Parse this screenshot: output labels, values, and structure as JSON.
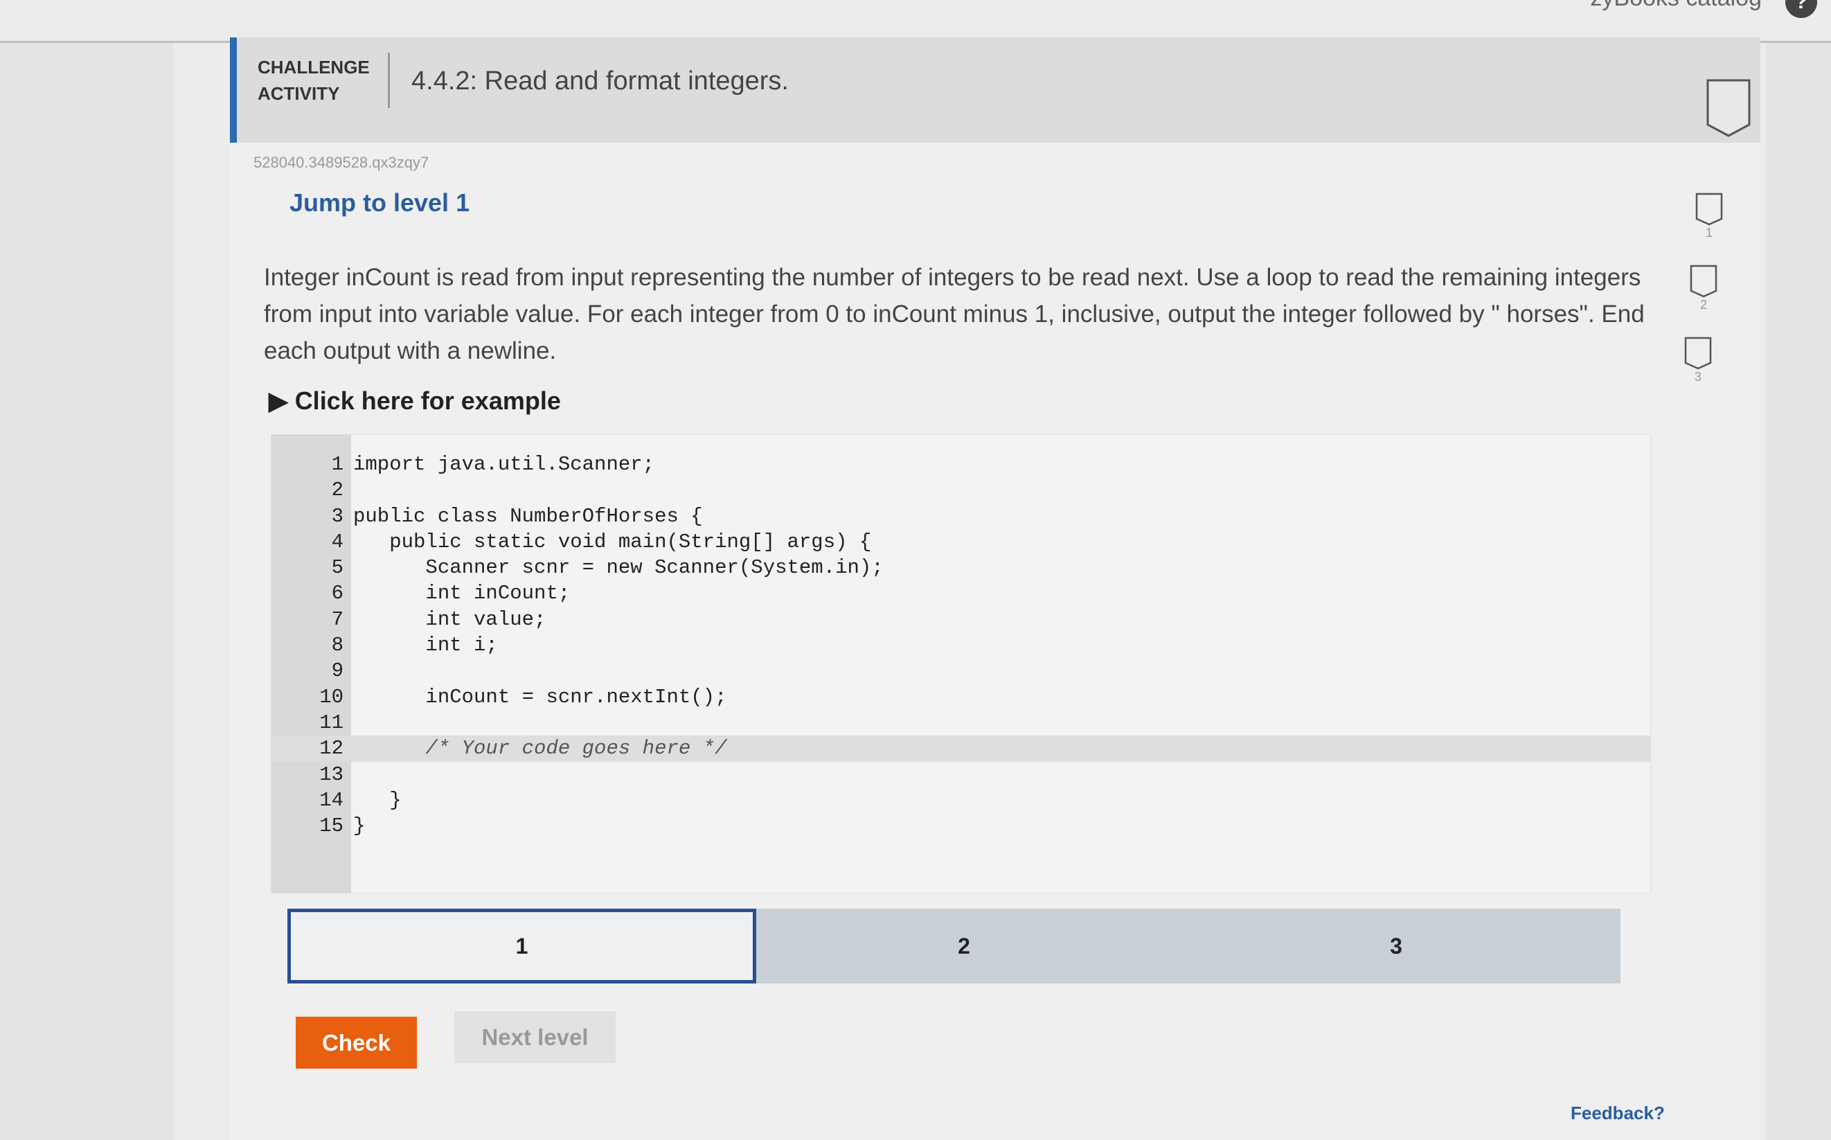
{
  "topbar": {
    "catalog_label": "zyBooks catalog",
    "help_icon": "question-icon"
  },
  "header": {
    "label_line1": "CHALLENGE",
    "label_line2": "ACTIVITY",
    "title": "4.4.2: Read and format integers."
  },
  "activity_id": "528040.3489528.qx3zqy7",
  "jump_label": "Jump to level 1",
  "instructions": "Integer inCount is read from input representing the number of integers to be read next. Use a loop to read the remaining integers from input into variable value. For each integer from 0 to inCount minus 1, inclusive, output the integer followed by \" horses\". End each output with a newline.",
  "example_label": "Click here for example",
  "code_lines": [
    {
      "n": "1",
      "text": "import java.util.Scanner;"
    },
    {
      "n": "2",
      "text": ""
    },
    {
      "n": "3",
      "text": "public class NumberOfHorses {"
    },
    {
      "n": "4",
      "text": "   public static void main(String[] args) {"
    },
    {
      "n": "5",
      "text": "      Scanner scnr = new Scanner(System.in);"
    },
    {
      "n": "6",
      "text": "      int inCount;"
    },
    {
      "n": "7",
      "text": "      int value;"
    },
    {
      "n": "8",
      "text": "      int i;"
    },
    {
      "n": "9",
      "text": ""
    },
    {
      "n": "10",
      "text": "      inCount = scnr.nextInt();"
    },
    {
      "n": "11",
      "text": ""
    },
    {
      "n": "12",
      "text": "      /* Your code goes here */"
    },
    {
      "n": "13",
      "text": ""
    },
    {
      "n": "14",
      "text": "   }"
    },
    {
      "n": "15",
      "text": "}"
    }
  ],
  "highlighted_line": "12",
  "levels": [
    "1",
    "2",
    "3"
  ],
  "active_level": "1",
  "buttons": {
    "check": "Check",
    "next_level": "Next level"
  },
  "feedback_label": "Feedback?",
  "level_badges": [
    "1",
    "2",
    "3"
  ],
  "colors": {
    "accent": "#2b6cb0",
    "check": "#e8600f",
    "link": "#2a5d9f"
  }
}
